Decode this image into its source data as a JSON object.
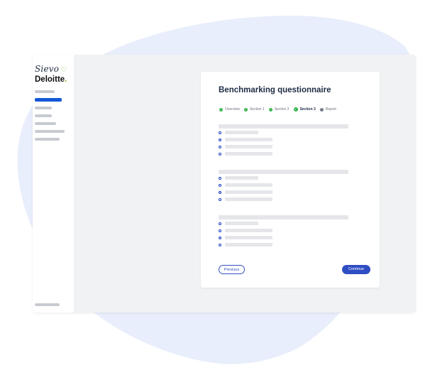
{
  "brand": {
    "name_top": "Sievo",
    "name_bottom": "Deloitte",
    "dot": ".",
    "heart_icon": "heart-outline-icon",
    "heart_glyph": "♡",
    "accent_color": "#7cc243"
  },
  "sidebar": {
    "items": [
      {
        "active": false
      },
      {
        "active": true
      },
      {
        "active": false
      },
      {
        "active": false
      },
      {
        "active": false
      },
      {
        "active": false
      },
      {
        "active": false
      }
    ]
  },
  "card": {
    "title": "Benchmarking questionnaire",
    "steps": [
      {
        "label": "Overview",
        "state": "done",
        "icon": "check-circle-icon",
        "glyph": "✓"
      },
      {
        "label": "Section 1",
        "state": "done",
        "icon": "check-circle-icon",
        "glyph": "✓"
      },
      {
        "label": "Section 2",
        "state": "done",
        "icon": "check-circle-icon",
        "glyph": "✓"
      },
      {
        "label": "Section 3",
        "state": "current",
        "icon": "check-circle-icon",
        "glyph": "✓"
      },
      {
        "label": "Report",
        "state": "upcoming",
        "icon": "info-circle-icon",
        "glyph": "i"
      }
    ],
    "questions": [
      {
        "options": [
          {
            "checked": false,
            "length": "short"
          },
          {
            "checked": true,
            "length": "long"
          },
          {
            "checked": false,
            "length": "long"
          },
          {
            "checked": false,
            "length": "long"
          }
        ]
      },
      {
        "options": [
          {
            "checked": false,
            "length": "short"
          },
          {
            "checked": false,
            "length": "long"
          },
          {
            "checked": true,
            "length": "long"
          },
          {
            "checked": false,
            "length": "long"
          }
        ]
      },
      {
        "options": [
          {
            "checked": false,
            "length": "short"
          },
          {
            "checked": false,
            "length": "long"
          },
          {
            "checked": true,
            "length": "long"
          },
          {
            "checked": false,
            "length": "long"
          }
        ]
      }
    ],
    "previous_label": "Previous",
    "continue_label": "Continue"
  },
  "colors": {
    "primary": "#2f4ec3",
    "nav_active": "#1359d6",
    "success": "#34b34a",
    "background_blob": "#e8eefb"
  }
}
